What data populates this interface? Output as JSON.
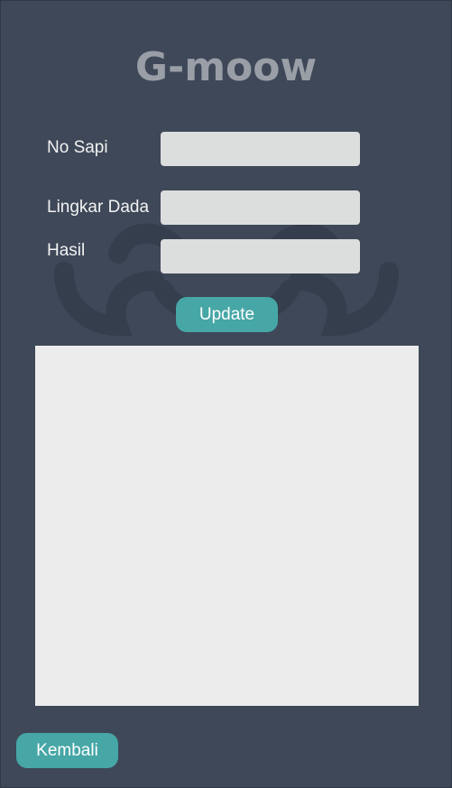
{
  "app": {
    "title": "G-moow"
  },
  "form": {
    "no_sapi": {
      "label": "No Sapi",
      "value": ""
    },
    "lingkar_dada": {
      "label": "Lingkar Dada",
      "value": ""
    },
    "hasil": {
      "label": "Hasil",
      "value": ""
    }
  },
  "buttons": {
    "update_label": "Update",
    "kembali_label": "Kembali"
  },
  "data_panel": {
    "items": []
  },
  "colors": {
    "background": "#3e4858",
    "title": "#9a9ea6",
    "field": "#dcdddd",
    "accent": "#47a6a6",
    "panel": "#ececec"
  }
}
